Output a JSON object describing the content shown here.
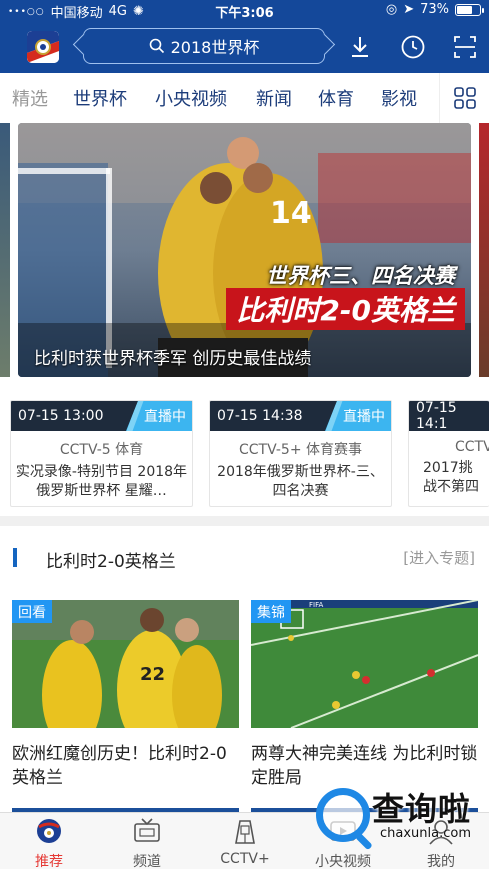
{
  "status_bar": {
    "signal": "•••○○",
    "carrier": "中国移动",
    "network": "4G",
    "time": "下午3:06",
    "battery": "73%",
    "battery_level": 0.73
  },
  "header": {
    "search_text": "2018世界杯",
    "logo_icon": "russia-2018-logo-icon",
    "icons": [
      "download-icon",
      "history-clock-icon",
      "scan-icon"
    ]
  },
  "tabs": [
    {
      "label": "精选",
      "active": true
    },
    {
      "label": "世界杯"
    },
    {
      "label": "小央视频"
    },
    {
      "label": "新闻"
    },
    {
      "label": "体育"
    },
    {
      "label": "影视"
    }
  ],
  "hero": {
    "subtitle": "世界杯三、四名决赛",
    "headline": "比利时2-0英格兰",
    "player_number": "14",
    "caption": "比利时获世界杯季军 创历史最佳战绩"
  },
  "live": [
    {
      "time": "07-15 13:00",
      "badge": "直播中",
      "channel": "CCTV-5 体育",
      "title": "实况录像-特别节目 2018年俄罗斯世界杯 星耀…"
    },
    {
      "time": "07-15 14:38",
      "badge": "直播中",
      "channel": "CCTV-5+ 体育赛事",
      "title": "2018年俄罗斯世界杯-三、四名决赛"
    },
    {
      "time": "07-15 14:1",
      "badge": "",
      "channel": "CCTV",
      "title": "2017挑战不第四"
    }
  ],
  "topic": {
    "title": "比利时2-0英格兰",
    "link": "[进入专题]"
  },
  "videos": [
    {
      "badge": "回看",
      "title": "欧洲红魔创历史！比利时2-0英格兰",
      "player_number": "22"
    },
    {
      "badge": "集锦",
      "title": "两尊大神完美连线 为比利时锁定胜局",
      "ad_text": "FIFA"
    }
  ],
  "bottom_nav": [
    {
      "label": "推荐",
      "icon": "worldcup-ball-icon",
      "active": true
    },
    {
      "label": "频道",
      "icon": "tv-icon"
    },
    {
      "label": "CCTV+",
      "icon": "cctv-plus-icon"
    },
    {
      "label": "小央视频",
      "icon": "video-icon"
    },
    {
      "label": "我的",
      "icon": "profile-icon"
    }
  ],
  "watermark": {
    "text": "查询啦",
    "sub": "chaxunla.com"
  },
  "colors": {
    "header_bg": "#14489a",
    "live_badge": "#3cb5f0",
    "headline_red": "#c8141b",
    "accent_blue": "#1565c0",
    "nav_active": "#e53935"
  }
}
